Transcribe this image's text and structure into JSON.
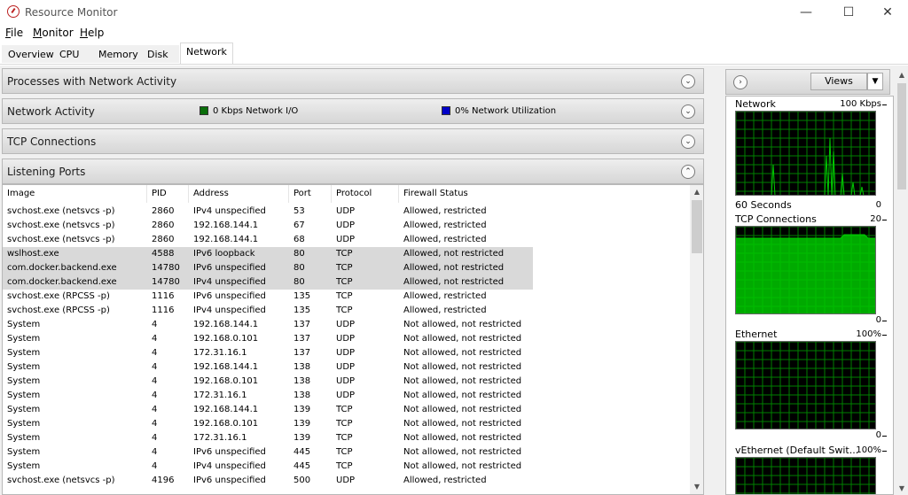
{
  "window": {
    "title": "Resource Monitor",
    "minimize": "—",
    "maximize": "☐",
    "close": "✕"
  },
  "menu": [
    {
      "label": "File",
      "accel": "F",
      "rest": "ile"
    },
    {
      "label": "Monitor",
      "accel": "M",
      "rest": "onitor"
    },
    {
      "label": "Help",
      "accel": "H",
      "rest": "elp"
    }
  ],
  "tabs": [
    {
      "label": "Overview",
      "active": false
    },
    {
      "label": "CPU",
      "active": false
    },
    {
      "label": "Memory",
      "active": false
    },
    {
      "label": "Disk",
      "active": false
    },
    {
      "label": "Network",
      "active": true
    }
  ],
  "sections": {
    "processes": {
      "title": "Processes with Network Activity",
      "collapsed": true
    },
    "activity": {
      "title": "Network Activity",
      "collapsed": true,
      "io_legend": "0 Kbps Network I/O",
      "io_color": "#0a6e0a",
      "util_legend": "0% Network Utilization",
      "util_color": "#0000c8"
    },
    "tcp": {
      "title": "TCP Connections",
      "collapsed": true
    },
    "listening": {
      "title": "Listening Ports",
      "collapsed": false
    }
  },
  "listening_table": {
    "columns": [
      "Image",
      "PID",
      "Address",
      "Port",
      "Protocol",
      "Firewall Status"
    ],
    "rows": [
      [
        "svchost.exe (netsvcs -p)",
        "2860",
        "IPv4 unspecified",
        "53",
        "UDP",
        "Allowed, restricted"
      ],
      [
        "svchost.exe (netsvcs -p)",
        "2860",
        "192.168.144.1",
        "67",
        "UDP",
        "Allowed, restricted"
      ],
      [
        "svchost.exe (netsvcs -p)",
        "2860",
        "192.168.144.1",
        "68",
        "UDP",
        "Allowed, restricted"
      ],
      [
        "wslhost.exe",
        "4588",
        "IPv6 loopback",
        "80",
        "TCP",
        "Allowed, not restricted"
      ],
      [
        "com.docker.backend.exe",
        "14780",
        "IPv6 unspecified",
        "80",
        "TCP",
        "Allowed, not restricted"
      ],
      [
        "com.docker.backend.exe",
        "14780",
        "IPv4 unspecified",
        "80",
        "TCP",
        "Allowed, not restricted"
      ],
      [
        "svchost.exe (RPCSS -p)",
        "1116",
        "IPv6 unspecified",
        "135",
        "TCP",
        "Allowed, restricted"
      ],
      [
        "svchost.exe (RPCSS -p)",
        "1116",
        "IPv4 unspecified",
        "135",
        "TCP",
        "Allowed, restricted"
      ],
      [
        "System",
        "4",
        "192.168.144.1",
        "137",
        "UDP",
        "Not allowed, not restricted"
      ],
      [
        "System",
        "4",
        "192.168.0.101",
        "137",
        "UDP",
        "Not allowed, not restricted"
      ],
      [
        "System",
        "4",
        "172.31.16.1",
        "137",
        "UDP",
        "Not allowed, not restricted"
      ],
      [
        "System",
        "4",
        "192.168.144.1",
        "138",
        "UDP",
        "Not allowed, not restricted"
      ],
      [
        "System",
        "4",
        "192.168.0.101",
        "138",
        "UDP",
        "Not allowed, not restricted"
      ],
      [
        "System",
        "4",
        "172.31.16.1",
        "138",
        "UDP",
        "Not allowed, not restricted"
      ],
      [
        "System",
        "4",
        "192.168.144.1",
        "139",
        "TCP",
        "Not allowed, not restricted"
      ],
      [
        "System",
        "4",
        "192.168.0.101",
        "139",
        "TCP",
        "Not allowed, not restricted"
      ],
      [
        "System",
        "4",
        "172.31.16.1",
        "139",
        "TCP",
        "Not allowed, not restricted"
      ],
      [
        "System",
        "4",
        "IPv6 unspecified",
        "445",
        "TCP",
        "Not allowed, not restricted"
      ],
      [
        "System",
        "4",
        "IPv4 unspecified",
        "445",
        "TCP",
        "Not allowed, not restricted"
      ],
      [
        "svchost.exe (netsvcs -p)",
        "4196",
        "IPv6 unspecified",
        "500",
        "UDP",
        "Allowed, restricted"
      ]
    ],
    "highlighted_rows": [
      3,
      4,
      5
    ]
  },
  "right_panel": {
    "views_label": "Views",
    "graphs": [
      {
        "name": "Network",
        "max": "100 Kbps",
        "footer_left": "60 Seconds",
        "footer_right": "0"
      },
      {
        "name": "TCP Connections",
        "max": "20",
        "footer_left": "",
        "footer_right": "0"
      },
      {
        "name": "Ethernet",
        "max": "100%",
        "footer_left": "",
        "footer_right": "0"
      },
      {
        "name": "vEthernet (Default Swit...",
        "max": "100%",
        "footer_left": "",
        "footer_right": ""
      }
    ],
    "graph_color": "#00c800",
    "grid_color": "#008000"
  }
}
